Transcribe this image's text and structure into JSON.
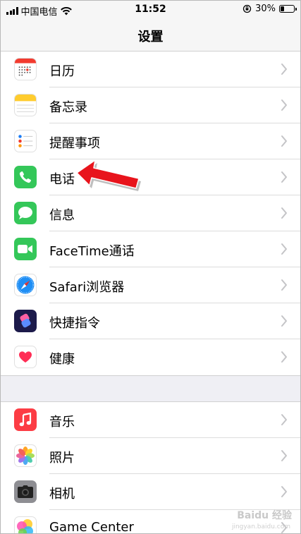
{
  "status": {
    "carrier": "中国电信",
    "time": "11:52",
    "battery": "30%",
    "battery_level": 0.3
  },
  "nav": {
    "title": "设置"
  },
  "group1": [
    {
      "label": "日历",
      "icon": "calendar-icon"
    },
    {
      "label": "备忘录",
      "icon": "notes-icon"
    },
    {
      "label": "提醒事项",
      "icon": "reminders-icon"
    },
    {
      "label": "电话",
      "icon": "phone-icon"
    },
    {
      "label": "信息",
      "icon": "messages-icon"
    },
    {
      "label": "FaceTime通话",
      "icon": "facetime-icon"
    },
    {
      "label": "Safari浏览器",
      "icon": "safari-icon"
    },
    {
      "label": "快捷指令",
      "icon": "shortcuts-icon"
    },
    {
      "label": "健康",
      "icon": "health-icon"
    }
  ],
  "group2": [
    {
      "label": "音乐",
      "icon": "music-icon"
    },
    {
      "label": "照片",
      "icon": "photos-icon"
    },
    {
      "label": "相机",
      "icon": "camera-icon"
    },
    {
      "label": "Game Center",
      "icon": "game-center-icon"
    }
  ],
  "watermark": {
    "text": "Baidu 经验",
    "sub": "jingyan.baidu.com"
  }
}
